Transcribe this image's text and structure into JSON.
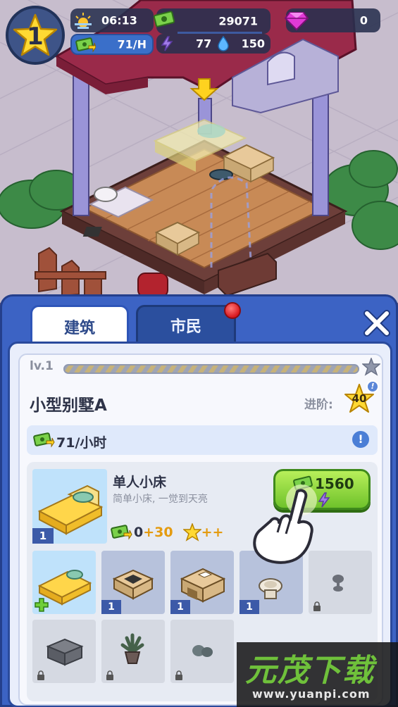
{
  "hud": {
    "level": "1",
    "time": "06:13",
    "rate": "71/H",
    "cash": "29071",
    "energy": "77",
    "water": "150",
    "gems": "0"
  },
  "tabs": [
    {
      "label": "建筑",
      "active": true
    },
    {
      "label": "市民",
      "active": false
    }
  ],
  "building": {
    "level": "lv.1",
    "name": "小型别墅A",
    "upgrade_label": "进阶:",
    "upgrade_cost": "40",
    "income": "71/小时"
  },
  "item": {
    "title": "单人小床",
    "desc": "简单小床, 一觉到天亮",
    "count": "1",
    "base": "0",
    "plus": "+30",
    "stars": "++",
    "price": "1560"
  },
  "slots": [
    {
      "name": "bed",
      "state": "selected",
      "count": ""
    },
    {
      "name": "stove",
      "state": "owned",
      "count": "1"
    },
    {
      "name": "desk",
      "state": "owned",
      "count": "1"
    },
    {
      "name": "toilet",
      "state": "owned",
      "count": "1"
    },
    {
      "name": "lamp",
      "state": "locked",
      "count": ""
    },
    {
      "name": "cabinet",
      "state": "locked",
      "count": ""
    },
    {
      "name": "plant",
      "state": "locked",
      "count": ""
    },
    {
      "name": "stool",
      "state": "locked",
      "count": ""
    }
  ],
  "watermark": {
    "brand": "元茂下载",
    "url": "www.yuanpi.com"
  },
  "colors": {
    "panel": "#3c63c4",
    "buy_green": "#7fd133",
    "gold": "#f5c518",
    "gem": "#e13ad6"
  }
}
